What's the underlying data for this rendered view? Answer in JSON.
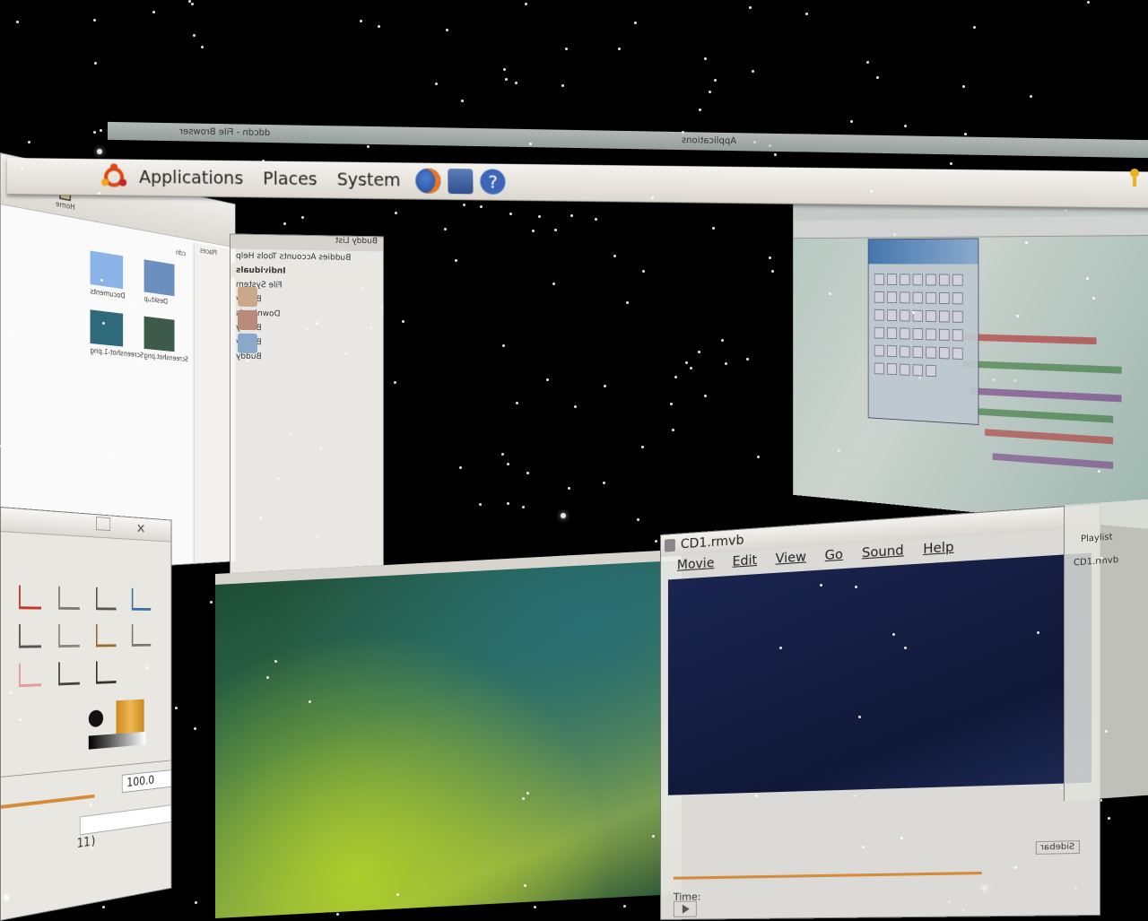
{
  "panel": {
    "menu_applications": "Applications",
    "menu_places": "Places",
    "menu_system": "System",
    "launchers": [
      "firefox-icon",
      "mail-icon",
      "help-icon"
    ]
  },
  "backstrip": {
    "left_text": "ddcdn - File Browser",
    "right_text": "Applications"
  },
  "file_browser": {
    "toolbar_home": "Home",
    "side_header": "Places",
    "location": "cdn",
    "icons": [
      {
        "name": "Documents"
      },
      {
        "name": "Desktop"
      },
      {
        "name": "Screenshot-1.png"
      },
      {
        "name": "Screenshot.png"
      }
    ]
  },
  "buddy_list": {
    "title": "Buddy List",
    "menu": "Buddies  Accounts  Tools  Help",
    "rows": [
      {
        "label": "Individuals",
        "group": true
      },
      {
        "label": "File System",
        "group": false
      },
      {
        "label": "Buddy",
        "group": false
      },
      {
        "label": "Downloads",
        "group": false
      },
      {
        "label": "Buddy",
        "group": false
      },
      {
        "label": "Buddy",
        "group": false
      },
      {
        "label": "Buddy",
        "group": false
      }
    ]
  },
  "player": {
    "title": "CD1.rmvb",
    "menu": [
      "Movie",
      "Edit",
      "View",
      "Go",
      "Sound",
      "Help"
    ],
    "time_label": "Time:",
    "sidebar_label": "Sidebar"
  },
  "playlist": {
    "label": "Playlist",
    "item": "CD1.rmvb"
  },
  "gimp": {
    "zoom_value": "100.0",
    "paren_text": "11)"
  },
  "colors": {
    "panel_bg": "#e6e3dd",
    "accent_orange": "#d58b3a",
    "ubuntu_orange": "#dd4814",
    "video_bg": "#101838"
  }
}
